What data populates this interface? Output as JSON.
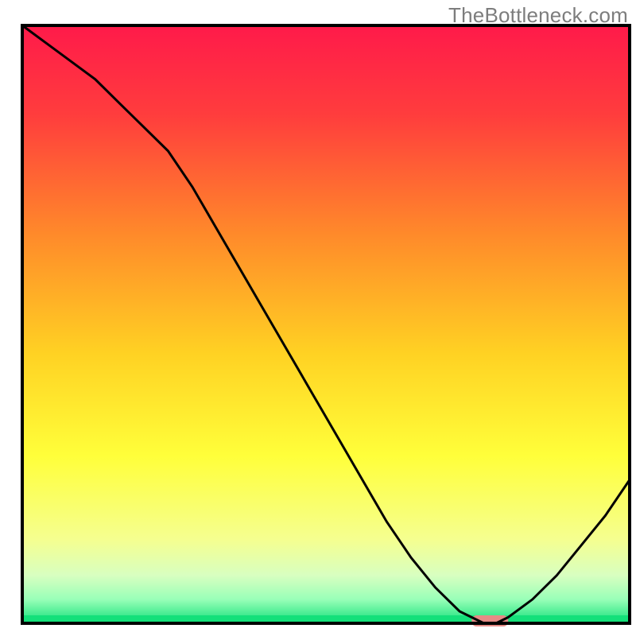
{
  "watermark": "TheBottleneck.com",
  "chart_data": {
    "type": "line",
    "title": "",
    "xlabel": "",
    "ylabel": "",
    "xlim": [
      0,
      100
    ],
    "ylim": [
      0,
      100
    ],
    "x": [
      0,
      4,
      8,
      12,
      16,
      20,
      24,
      28,
      32,
      36,
      40,
      44,
      48,
      52,
      56,
      60,
      64,
      68,
      72,
      74,
      76,
      78,
      80,
      84,
      88,
      92,
      96,
      100
    ],
    "values": [
      100,
      97,
      94,
      91,
      87,
      83,
      79,
      73,
      66,
      59,
      52,
      45,
      38,
      31,
      24,
      17,
      11,
      6,
      2,
      1,
      0,
      0,
      1,
      4,
      8,
      13,
      18,
      24
    ],
    "marker_region": {
      "x_start": 74,
      "x_end": 80,
      "y": 0,
      "color": "#e68b86"
    },
    "background_gradient": {
      "stops": [
        {
          "offset": 0.0,
          "color": "#ff1a4a"
        },
        {
          "offset": 0.15,
          "color": "#ff3d3d"
        },
        {
          "offset": 0.35,
          "color": "#ff8a2a"
        },
        {
          "offset": 0.55,
          "color": "#ffd223"
        },
        {
          "offset": 0.72,
          "color": "#ffff3a"
        },
        {
          "offset": 0.86,
          "color": "#f5ff90"
        },
        {
          "offset": 0.92,
          "color": "#d8ffc0"
        },
        {
          "offset": 0.96,
          "color": "#99ffb8"
        },
        {
          "offset": 1.0,
          "color": "#14e07a"
        }
      ]
    },
    "border_color": "#000000"
  }
}
